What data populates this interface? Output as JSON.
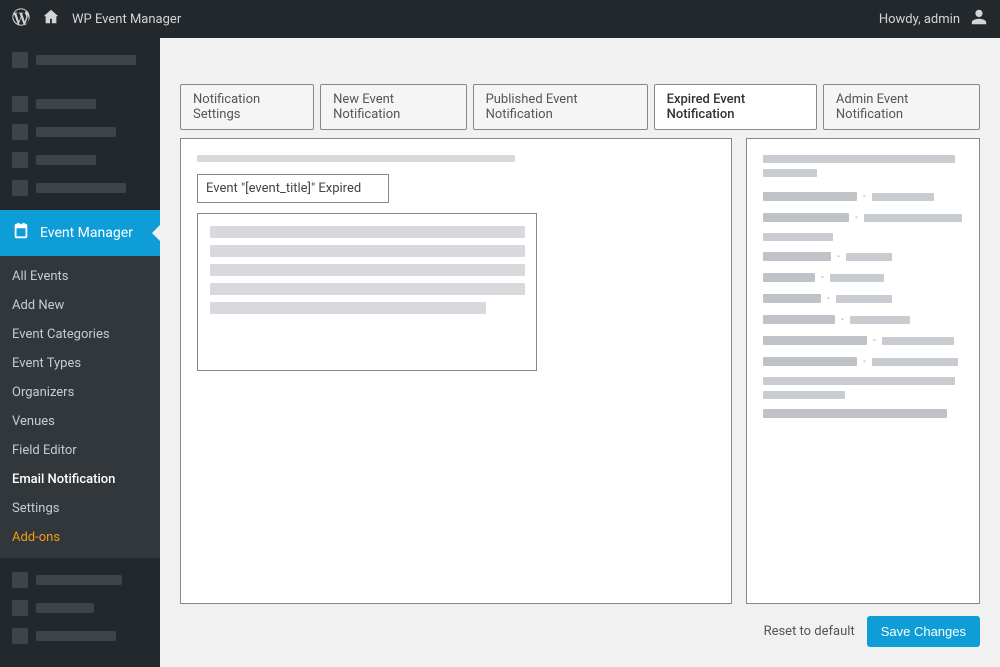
{
  "adminBar": {
    "siteTitle": "WP Event Manager",
    "greeting": "Howdy, admin"
  },
  "sidebar": {
    "activeLabel": "Event Manager",
    "submenu": [
      "All Events",
      "Add New",
      "Event Categories",
      "Event Types",
      "Organizers",
      "Venues",
      "Field Editor",
      "Email Notification",
      "Settings",
      "Add-ons"
    ]
  },
  "tabs": [
    "Notification Settings",
    "New Event Notification",
    "Published Event Notification",
    "Expired Event Notification",
    "Admin Event Notification"
  ],
  "form": {
    "subjectValue": "Event \"[event_title]\" Expired"
  },
  "actions": {
    "reset": "Reset to default",
    "save": "Save Changes"
  }
}
